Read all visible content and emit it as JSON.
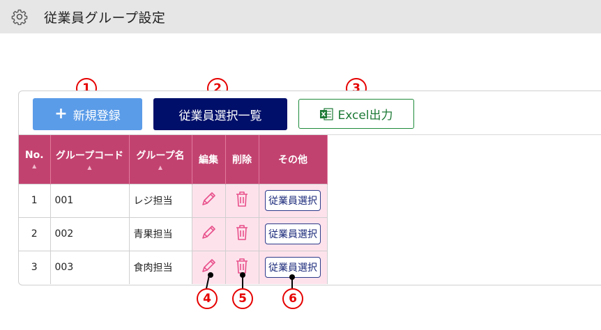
{
  "header": {
    "title": "従業員グループ設定",
    "icon": "gear-icon"
  },
  "toolbar": {
    "new_label": "新規登録",
    "list_label": "従業員選択一覧",
    "excel_label": "Excel出力"
  },
  "markers": [
    "1",
    "2",
    "3",
    "4",
    "5",
    "6"
  ],
  "table": {
    "columns": [
      "No.",
      "グループコード",
      "グループ名",
      "編集",
      "削除",
      "その他"
    ],
    "rows": [
      {
        "no": "1",
        "code": "001",
        "name": "レジ担当",
        "action": "従業員選択"
      },
      {
        "no": "2",
        "code": "002",
        "name": "青果担当",
        "action": "従業員選択"
      },
      {
        "no": "3",
        "code": "003",
        "name": "食肉担当",
        "action": "従業員選択"
      }
    ]
  },
  "colors": {
    "header_bg": "#c2426f",
    "action_bg": "#fde2ec",
    "new_button": "#5b9ce8",
    "list_button": "#000f6a",
    "excel_green": "#1d8a3a",
    "marker_red": "#e60000"
  }
}
